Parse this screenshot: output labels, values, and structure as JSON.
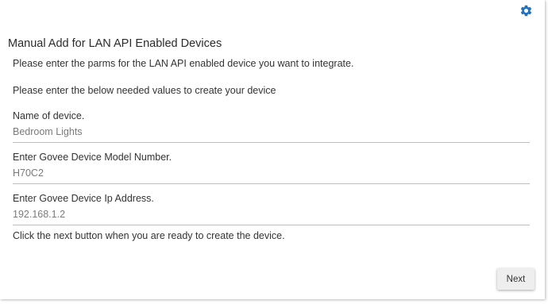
{
  "header": {
    "settings_icon": "gear-icon",
    "accent_color": "#1a73c8"
  },
  "dialog": {
    "title": "Manual Add for LAN API Enabled Devices",
    "intro": "Please enter the parms for the LAN API enabled device you want to integrate.",
    "instructions": "Please enter the below needed values to create your device",
    "fields": [
      {
        "label": "Name of device.",
        "value": "Bedroom Lights"
      },
      {
        "label": "Enter Govee Device Model Number.",
        "value": "H70C2"
      },
      {
        "label": "Enter Govee Device Ip Address.",
        "value": "192.168.1.2"
      }
    ],
    "footer_text": "Click the next button when you are ready to create the device.",
    "next_label": "Next"
  }
}
